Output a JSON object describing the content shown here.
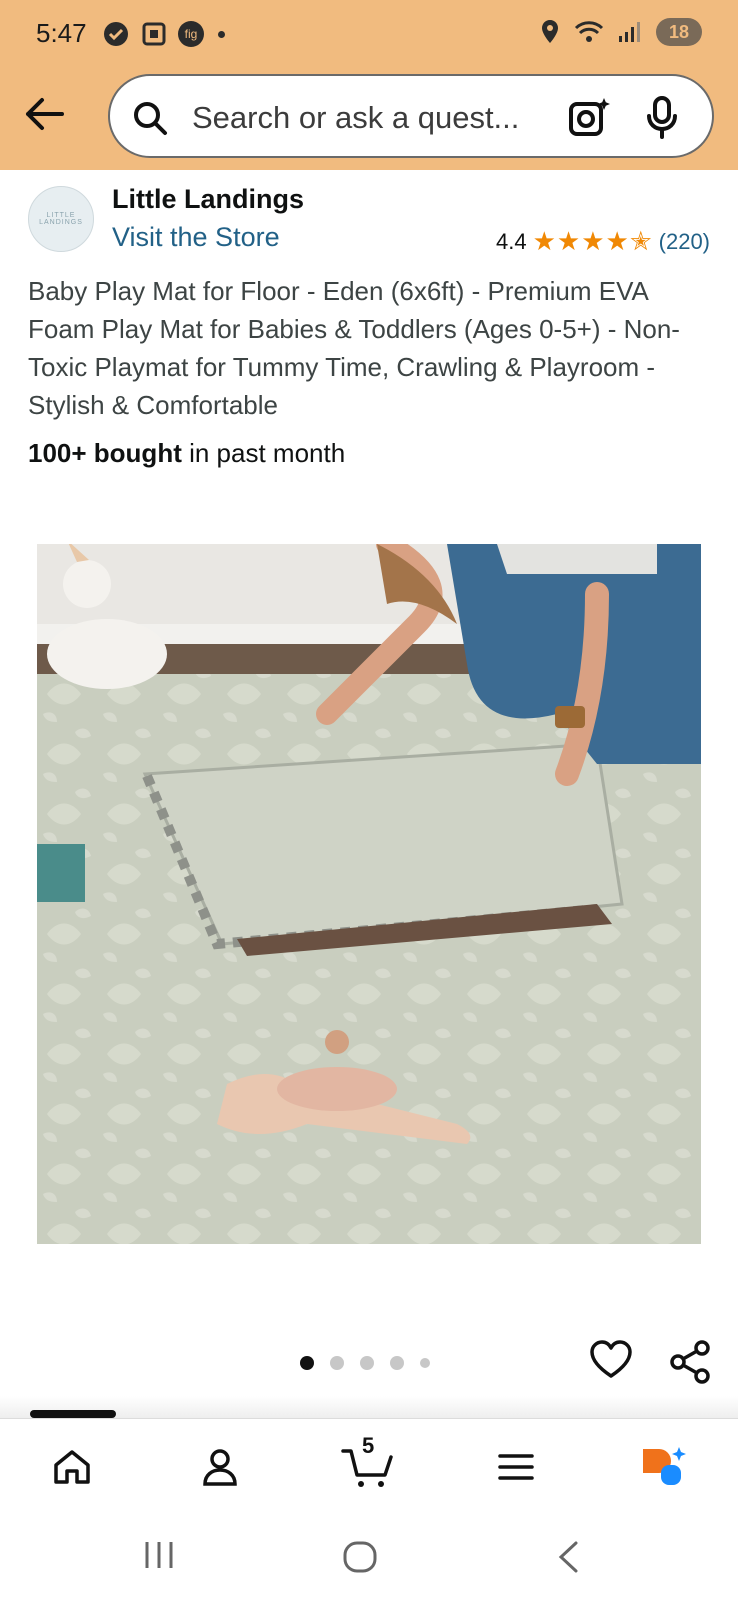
{
  "status_bar": {
    "time": "5:47",
    "app_badge": "fig",
    "battery": "18"
  },
  "search": {
    "placeholder": "Search or ask a quest..."
  },
  "brand": {
    "logo_text_line1": "LITTLE",
    "logo_text_line2": "LANDINGS",
    "name": "Little Landings",
    "visit_store": "Visit the Store"
  },
  "rating": {
    "value": "4.4",
    "stars": "★★★★✭",
    "count": "(220)",
    "stars_fraction": 0.88
  },
  "product": {
    "title": "Baby Play Mat for Floor - Eden (6x6ft) - Premium EVA Foam Play Mat for Babies & Toddlers (Ages 0-5+) - Non-Toxic Playmat for Tummy Time, Crawling & Playroom - Stylish & Comfortable",
    "bought_bold": "100+ bought",
    "bought_rest": " in past month"
  },
  "carousel": {
    "total_dots": 5,
    "active_index": 0
  },
  "bottom_nav": {
    "items": [
      "home-icon",
      "account-icon",
      "cart-icon",
      "menu-icon",
      "rufus-icon"
    ],
    "cart_count": "5"
  },
  "colors": {
    "header_bg": "#f1bb7f",
    "link": "#226187",
    "star": "#f08804",
    "rufus_orange": "#f0721b",
    "rufus_blue": "#1a8cff"
  }
}
